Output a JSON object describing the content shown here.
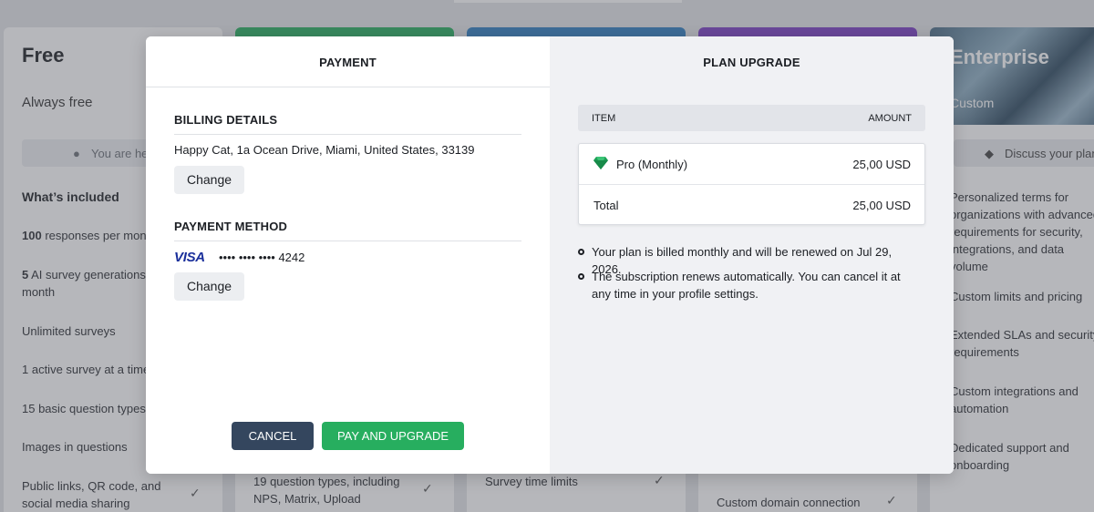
{
  "background": {
    "free": {
      "title": "Free",
      "subtitle": "Always free",
      "current_label": "You are he",
      "included_heading": "What’s included",
      "features": [
        {
          "bold": "100",
          "text": " responses per mont"
        },
        {
          "bold": "5",
          "text": " AI survey generations p"
        },
        {
          "bold": "",
          "text": "month"
        },
        {
          "bold": "",
          "text": "Unlimited surveys"
        },
        {
          "bold": "",
          "text": "1 active survey at a time"
        },
        {
          "bold": "",
          "text": "15 basic question types"
        },
        {
          "bold": "",
          "text": "Images in questions"
        },
        {
          "bold": "",
          "text": "Public links, QR code, and"
        },
        {
          "bold": "",
          "text": "social media sharing"
        }
      ]
    },
    "card2_text": [
      "19 question types, including",
      "NPS, Matrix, Upload"
    ],
    "card3_text": "Survey time limits",
    "card4_text": "Custom domain connection",
    "enterprise": {
      "title": "Enterprise",
      "subtitle": "Custom",
      "button_label": "Discuss your plan",
      "features": [
        "Personalized terms for",
        "organizations with advanced",
        "requirements for security,",
        "integrations, and data volume",
        "Custom limits and pricing",
        "Extended SLAs and security",
        "requirements",
        "Custom integrations and",
        "automation",
        "Dedicated support and",
        "onboarding"
      ]
    },
    "colors": {
      "card2": "#27ae5f",
      "card3": "#2f7fc1",
      "card4": "#7b3fc4"
    }
  },
  "modal": {
    "payment": {
      "heading": "PAYMENT",
      "billing_title": "BILLING DETAILS",
      "billing_address": "Happy Cat, 1a Ocean Drive, Miami, United States, 33139",
      "change_label": "Change",
      "method_title": "PAYMENT METHOD",
      "card_brand": "VISA",
      "card_number": "•••• •••• •••• 4242",
      "change_label_2": "Change",
      "cancel_label": "CANCEL",
      "pay_label": "PAY AND UPGRADE"
    },
    "upgrade": {
      "heading": "PLAN UPGRADE",
      "col_item": "ITEM",
      "col_amount": "AMOUNT",
      "rows": [
        {
          "item": "Pro (Monthly)",
          "amount": "25,00 USD",
          "icon": "diamond-icon"
        },
        {
          "item": "Total",
          "amount": "25,00 USD"
        }
      ],
      "notes": [
        "Your plan is billed monthly and will be renewed on Jul 29, 2026.",
        "The subscription renews automatically. You can cancel it at any time in your profile settings."
      ]
    }
  }
}
